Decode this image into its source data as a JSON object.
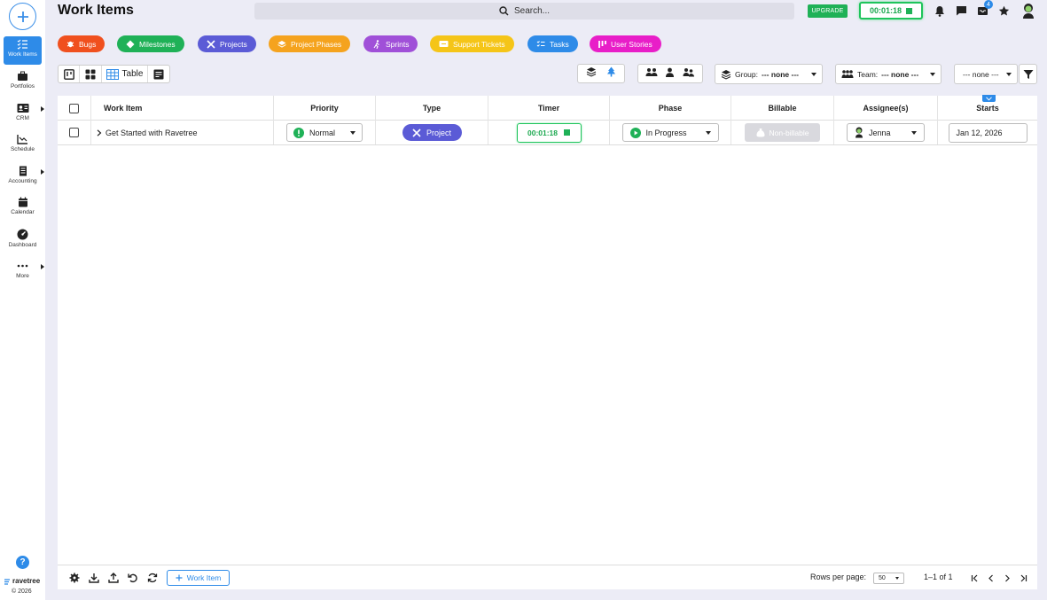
{
  "sidebar": {
    "items": [
      {
        "label": "Work Items",
        "icon": "checklist-icon",
        "active": true
      },
      {
        "label": "Portfolios",
        "icon": "briefcase-icon"
      },
      {
        "label": "CRM",
        "icon": "contact-card-icon",
        "has_submenu": true
      },
      {
        "label": "Schedule",
        "icon": "schedule-chart-icon"
      },
      {
        "label": "Accounting",
        "icon": "receipt-icon",
        "has_submenu": true
      },
      {
        "label": "Calendar",
        "icon": "calendar-icon"
      },
      {
        "label": "Dashboard",
        "icon": "gauge-icon"
      },
      {
        "label": "More",
        "icon": "ellipsis-icon",
        "has_submenu": true
      }
    ],
    "help": "?",
    "brand": "ravetree",
    "copyright": "© 2026"
  },
  "header": {
    "title": "Work Items",
    "search_placeholder": "Search...",
    "upgrade_label": "UPGRADE",
    "timer": "00:01:18",
    "notification_count": "4"
  },
  "chips": [
    {
      "label": "Bugs",
      "color": "#f0501e",
      "icon": "bug-icon"
    },
    {
      "label": "Milestones",
      "color": "#1fb157",
      "icon": "diamond-icon"
    },
    {
      "label": "Projects",
      "color": "#5b5bd6",
      "icon": "tools-icon"
    },
    {
      "label": "Project Phases",
      "color": "#f5a31e",
      "icon": "layers-icon"
    },
    {
      "label": "Sprints",
      "color": "#a050d8",
      "icon": "runner-icon"
    },
    {
      "label": "Support Tickets",
      "color": "#f5c518",
      "icon": "ticket-icon"
    },
    {
      "label": "Tasks",
      "color": "#2e8be8",
      "icon": "checklist-icon"
    },
    {
      "label": "User Stories",
      "color": "#e81ec8",
      "icon": "story-icon"
    }
  ],
  "toolbar": {
    "table_label": "Table",
    "group_label": "Group:",
    "group_value": "--- none ---",
    "team_label": "Team:",
    "team_value": "--- none ---",
    "third_value": "--- none ---"
  },
  "table": {
    "columns": [
      "Work Item",
      "Priority",
      "Type",
      "Timer",
      "Phase",
      "Billable",
      "Assignee(s)",
      "Starts"
    ],
    "rows": [
      {
        "work_item": "Get Started with Ravetree",
        "priority": "Normal",
        "type": "Project",
        "timer": "00:01:18",
        "phase": "In Progress",
        "billable": "Non-billable",
        "assignee": "Jenna",
        "starts": "Jan 12, 2026"
      }
    ]
  },
  "footer": {
    "add_label": "Work Item",
    "rows_per_page_label": "Rows per page:",
    "rows_per_page": "50",
    "range": "1–1 of 1"
  },
  "colors": {
    "accent": "#2e8be8",
    "green": "#1fb157",
    "background": "#ececf6"
  }
}
